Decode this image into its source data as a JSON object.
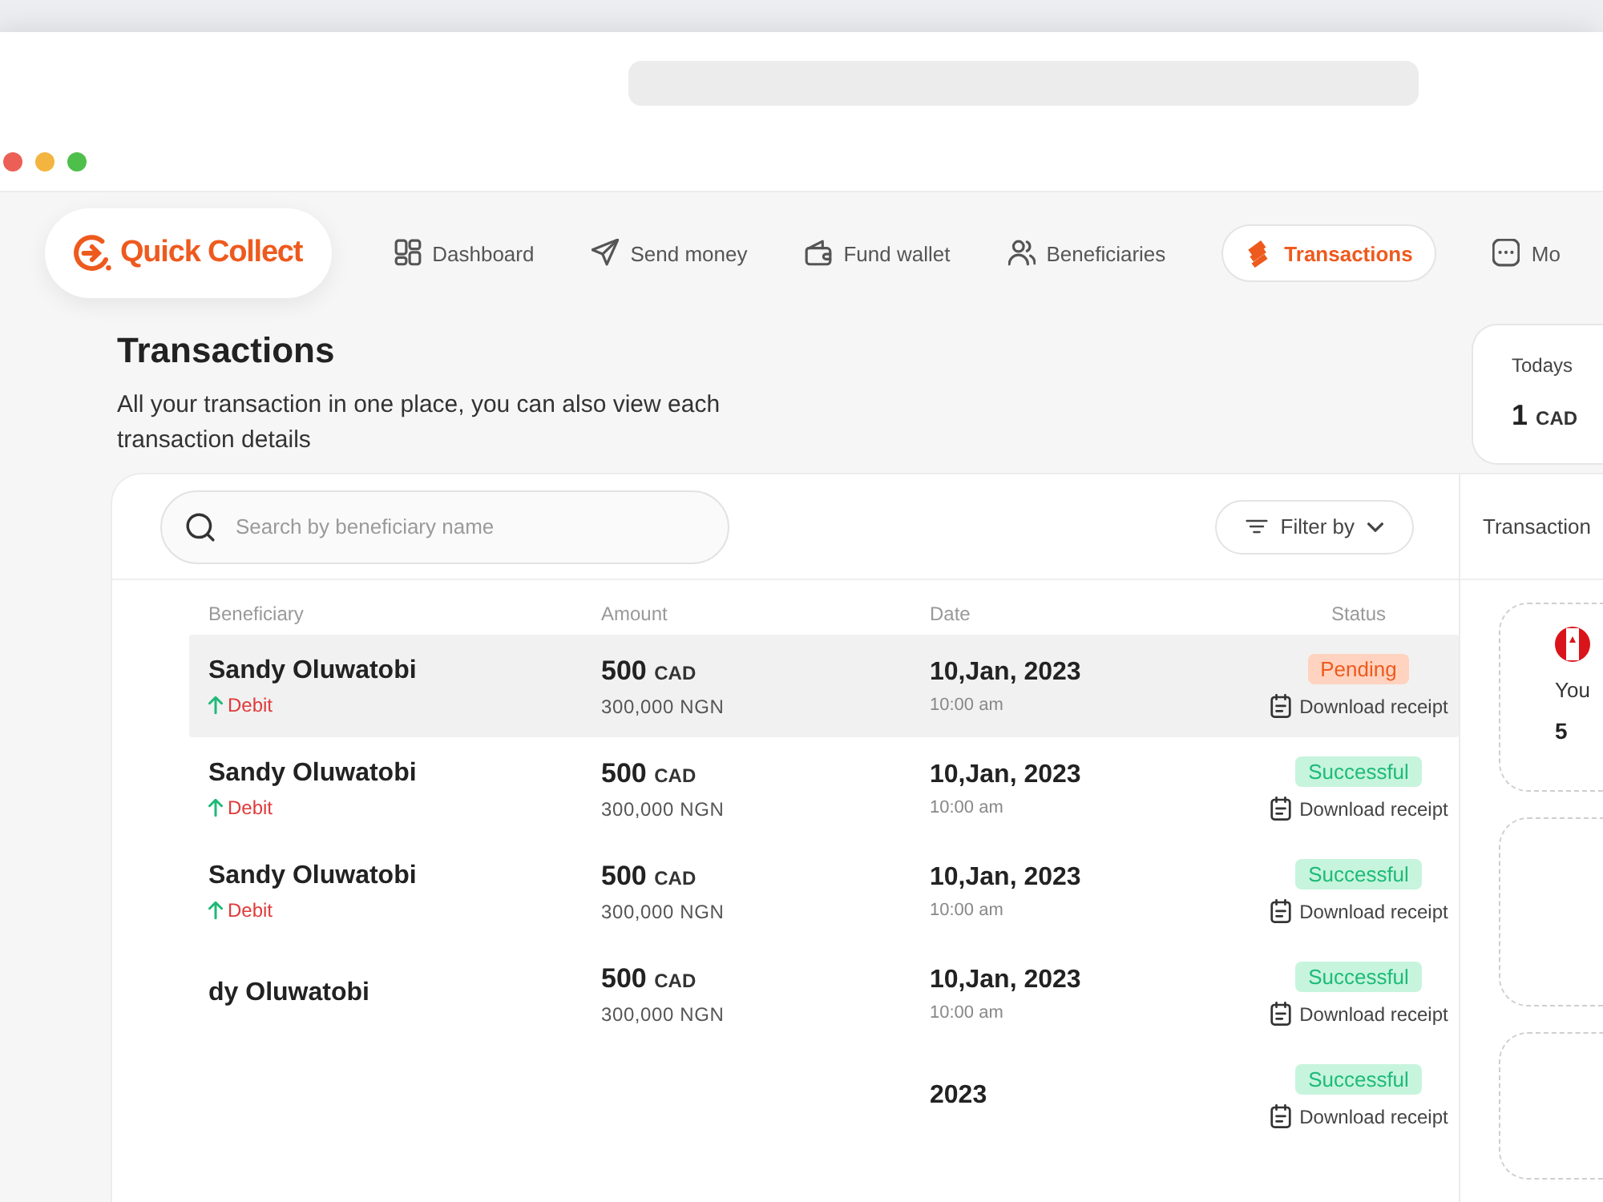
{
  "browser": {
    "traffic_lights": [
      {
        "color": "#ec5f57"
      },
      {
        "color": "#f3b53f"
      },
      {
        "color": "#4fbf4b"
      }
    ]
  },
  "nav": {
    "logo": "Quick Collect",
    "items": [
      {
        "label": "Dashboard",
        "selected": false
      },
      {
        "label": "Send money",
        "selected": false
      },
      {
        "label": "Fund wallet",
        "selected": false
      },
      {
        "label": "Beneficiaries",
        "selected": false
      },
      {
        "label": "Transactions",
        "selected": true
      },
      {
        "label": "Mo",
        "selected": false
      }
    ]
  },
  "rate_card": {
    "title": "Todays",
    "value": "1",
    "unit": "CAD"
  },
  "page": {
    "title": "Transactions",
    "subtitle": "All your transaction in one place, you can also view each transaction details"
  },
  "search": {
    "placeholder": "Search by beneficiary name"
  },
  "filter": {
    "label": "Filter by"
  },
  "table": {
    "columns": [
      "Beneficiary",
      "Amount",
      "Date",
      "Status"
    ],
    "rows": [
      {
        "selected": true,
        "name": "Sandy Oluwatobi",
        "type": "Debit",
        "amount": "500",
        "currency": "CAD",
        "converted": "300,000 NGN",
        "date": "10,Jan, 2023",
        "time": "10:00 am",
        "status": {
          "label": "Pending",
          "kind": "pending"
        },
        "receipt": "Download receipt"
      },
      {
        "selected": false,
        "name": "Sandy Oluwatobi",
        "type": "Debit",
        "amount": "500",
        "currency": "CAD",
        "converted": "300,000 NGN",
        "date": "10,Jan, 2023",
        "time": "10:00 am",
        "status": {
          "label": "Successful",
          "kind": "successful"
        },
        "receipt": "Download receipt"
      },
      {
        "selected": false,
        "name": "Sandy Oluwatobi",
        "type": "Debit",
        "amount": "500",
        "currency": "CAD",
        "converted": "300,000 NGN",
        "date": "10,Jan, 2023",
        "time": "10:00 am",
        "status": {
          "label": "Successful",
          "kind": "successful"
        },
        "receipt": "Download receipt"
      },
      {
        "selected": false,
        "name": "dy Oluwatobi",
        "amount": "500",
        "currency": "CAD",
        "converted": "300,000 NGN",
        "date": "10,Jan, 2023",
        "time": "10:00 am",
        "status": {
          "label": "Successful",
          "kind": "successful"
        },
        "receipt": "Download receipt"
      },
      {
        "selected": false,
        "date": "2023",
        "status": {
          "label": "Successful",
          "kind": "successful"
        },
        "receipt": "Download receipt"
      }
    ]
  },
  "side_panel": {
    "title": "Transaction",
    "cards": [
      {
        "kind": "detail",
        "label": "You",
        "value": "5"
      },
      {
        "kind": "blank"
      },
      {
        "kind": "blank"
      }
    ]
  }
}
